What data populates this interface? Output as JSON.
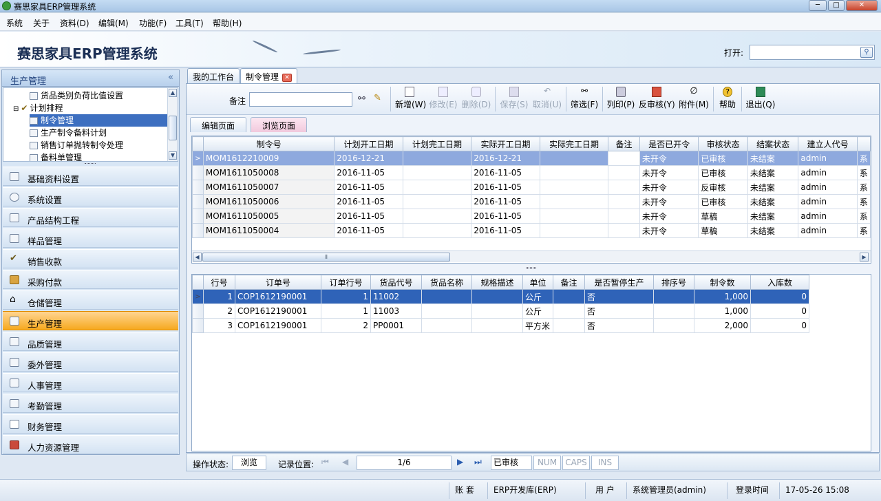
{
  "window": {
    "title": "赛思家具ERP管理系统",
    "min": "─",
    "max": "□",
    "close": "✕"
  },
  "menu": [
    "系统",
    "关于",
    "资料(D)",
    "编辑(M)",
    "功能(F)",
    "工具(T)",
    "帮助(H)"
  ],
  "banner": {
    "title": "赛思家具ERP管理系统",
    "open_label": "打开:",
    "open_value": ""
  },
  "sidebar": {
    "header": "生产管理",
    "collapse": "«",
    "tree": [
      {
        "label": "货品类别负荷比值设置",
        "level": 2
      },
      {
        "label": "计划排程",
        "level": 1
      },
      {
        "label": "制令管理",
        "level": 2,
        "selected": true
      },
      {
        "label": "生产制令备料计划",
        "level": 2
      },
      {
        "label": "销售订单抛转制令处理",
        "level": 2
      },
      {
        "label": "备料单管理",
        "level": 2
      }
    ],
    "nav": [
      {
        "label": "基础资料设置"
      },
      {
        "label": "系统设置"
      },
      {
        "label": "产品结构工程"
      },
      {
        "label": "样品管理"
      },
      {
        "label": "销售收款"
      },
      {
        "label": "采购付款"
      },
      {
        "label": "仓储管理"
      },
      {
        "label": "生产管理",
        "active": true
      },
      {
        "label": "品质管理"
      },
      {
        "label": "委外管理"
      },
      {
        "label": "人事管理"
      },
      {
        "label": "考勤管理"
      },
      {
        "label": "财务管理"
      },
      {
        "label": "人力资源管理"
      }
    ]
  },
  "tabs": [
    {
      "label": "我的工作台"
    },
    {
      "label": "制令管理",
      "active": true
    }
  ],
  "toolbar": {
    "remark_label": "备注",
    "remark_value": "",
    "buttons": [
      {
        "label": "新增(W)",
        "icon": "new-doc-icon",
        "enabled": true
      },
      {
        "label": "修改(E)",
        "icon": "edit-icon",
        "enabled": false
      },
      {
        "label": "删除(D)",
        "icon": "delete-icon",
        "enabled": false
      },
      {
        "label": "保存(S)",
        "icon": "save-icon",
        "enabled": false
      },
      {
        "label": "取消(U)",
        "icon": "undo-icon",
        "enabled": false
      },
      {
        "label": "筛选(F)",
        "icon": "binoculars-icon",
        "enabled": true
      },
      {
        "label": "列印(P)",
        "icon": "printer-icon",
        "enabled": true
      },
      {
        "label": "反审核(Y)",
        "icon": "unapprove-icon",
        "enabled": true
      },
      {
        "label": "附件(M)",
        "icon": "paperclip-icon",
        "enabled": true
      },
      {
        "label": "帮助",
        "icon": "help-icon",
        "enabled": true
      },
      {
        "label": "退出(Q)",
        "icon": "exit-icon",
        "enabled": true
      }
    ]
  },
  "subtabs": [
    {
      "label": "编辑页面"
    },
    {
      "label": "浏览页面",
      "active": true
    }
  ],
  "master": {
    "columns": [
      "制令号",
      "计划开工日期",
      "计划完工日期",
      "实际开工日期",
      "实际完工日期",
      "备注",
      "是否已开令",
      "审核状态",
      "结案状态",
      "建立人代号",
      ""
    ],
    "rows": [
      [
        "MOM1612210009",
        "2016-12-21",
        "",
        "2016-12-21",
        "",
        "",
        "未开令",
        "已审核",
        "未结案",
        "admin",
        "系"
      ],
      [
        "MOM1611050008",
        "2016-11-05",
        "",
        "2016-11-05",
        "",
        "",
        "未开令",
        "已审核",
        "未结案",
        "admin",
        "系"
      ],
      [
        "MOM1611050007",
        "2016-11-05",
        "",
        "2016-11-05",
        "",
        "",
        "未开令",
        "反审核",
        "未结案",
        "admin",
        "系"
      ],
      [
        "MOM1611050006",
        "2016-11-05",
        "",
        "2016-11-05",
        "",
        "",
        "未开令",
        "已审核",
        "未结案",
        "admin",
        "系"
      ],
      [
        "MOM1611050005",
        "2016-11-05",
        "",
        "2016-11-05",
        "",
        "",
        "未开令",
        "草稿",
        "未结案",
        "admin",
        "系"
      ],
      [
        "MOM1611050004",
        "2016-11-05",
        "",
        "2016-11-05",
        "",
        "",
        "未开令",
        "草稿",
        "未结案",
        "admin",
        "系"
      ]
    ],
    "row_pointer": ">"
  },
  "detail": {
    "columns": [
      "行号",
      "订单号",
      "订单行号",
      "货品代号",
      "货品名称",
      "规格描述",
      "单位",
      "备注",
      "是否暂停生产",
      "排序号",
      "制令数",
      "入库数"
    ],
    "rows": [
      [
        "1",
        "COP1612190001",
        "1",
        "11002",
        "",
        "",
        "公斤",
        "",
        "否",
        "",
        "1,000",
        "0"
      ],
      [
        "2",
        "COP1612190001",
        "1",
        "11003",
        "",
        "",
        "公斤",
        "",
        "否",
        "",
        "1,000",
        "0"
      ],
      [
        "3",
        "COP1612190001",
        "2",
        "PP0001",
        "",
        "",
        "平方米",
        "",
        "否",
        "",
        "2,000",
        "0"
      ]
    ],
    "row_pointer": ">"
  },
  "navbar": {
    "op_label": "操作状态:",
    "op_value": "浏览",
    "pos_label": "记录位置:",
    "position": "1/6",
    "audit": "已审核",
    "num": "NUM",
    "caps": "CAPS",
    "ins": "INS",
    "first": "⏮",
    "prev": "◀",
    "next": "▶",
    "last": "⏭"
  },
  "status": {
    "account_label": "账 套",
    "account_value": "ERP开发库(ERP)",
    "user_label": "用 户",
    "user_value": "系统管理员(admin)",
    "login_label": "登录时间",
    "login_value": "17-05-26 15:08"
  }
}
